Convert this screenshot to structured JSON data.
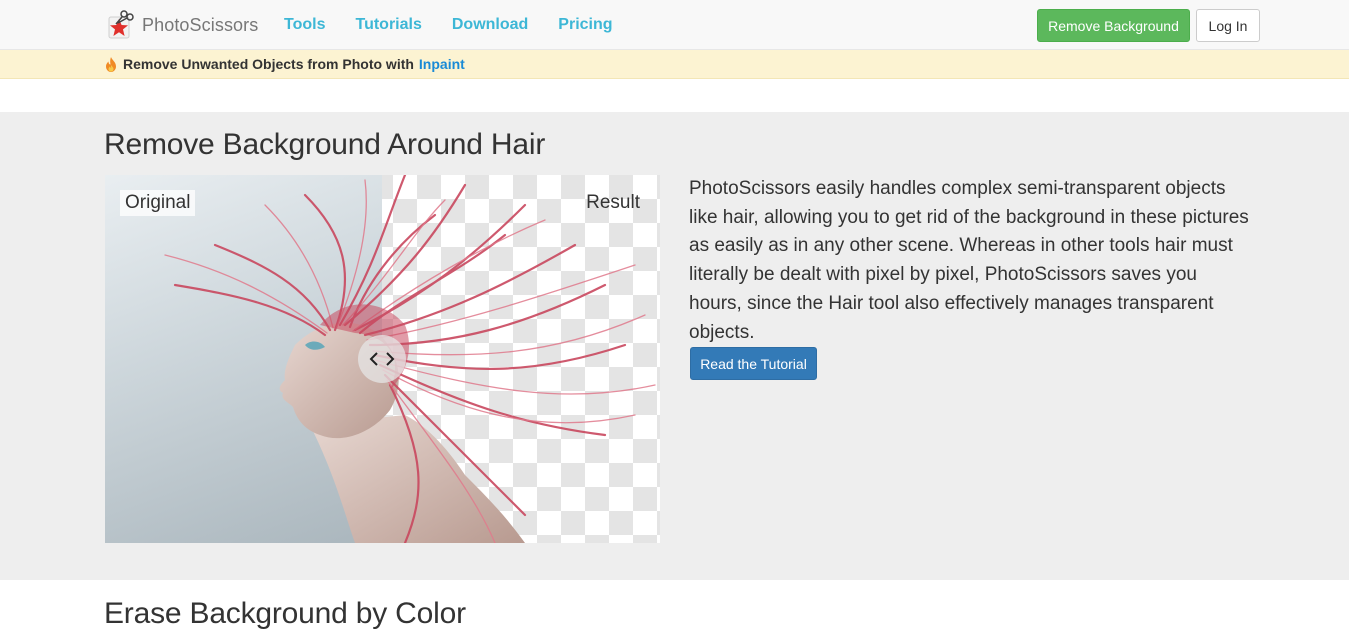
{
  "navbar": {
    "brand": "PhotoScissors",
    "links": [
      "Tools",
      "Tutorials",
      "Download",
      "Pricing"
    ],
    "remove_background_label": "Remove Background",
    "login_label": "Log In"
  },
  "promo": {
    "text": "Remove Unwanted Objects from Photo with",
    "link": "Inpaint"
  },
  "hair_section": {
    "title": "Remove Background Around Hair",
    "label_original": "Original",
    "label_result": "Result",
    "description": "PhotoScissors easily handles complex semi-transparent objects like hair, allowing you to get rid of the background in these pictures as easily as in any other scene. Whereas in other tools hair must literally be dealt with pixel by pixel, PhotoScissors saves you hours, since the Hair tool also effectively manages transparent objects.",
    "button_label": "Read the Tutorial"
  },
  "color_section": {
    "title": "Erase Background by Color"
  },
  "colors": {
    "nav_link": "#3db7d6",
    "success": "#5cb85c",
    "primary": "#337ab7",
    "promo_bg": "#fcf3d2",
    "promo_link": "#1a8ad6",
    "section_gray": "#eeeeee"
  },
  "icons": {
    "logo": "scissors-star-logo",
    "promo": "fire-icon",
    "handle": "compare-arrows-icon"
  }
}
